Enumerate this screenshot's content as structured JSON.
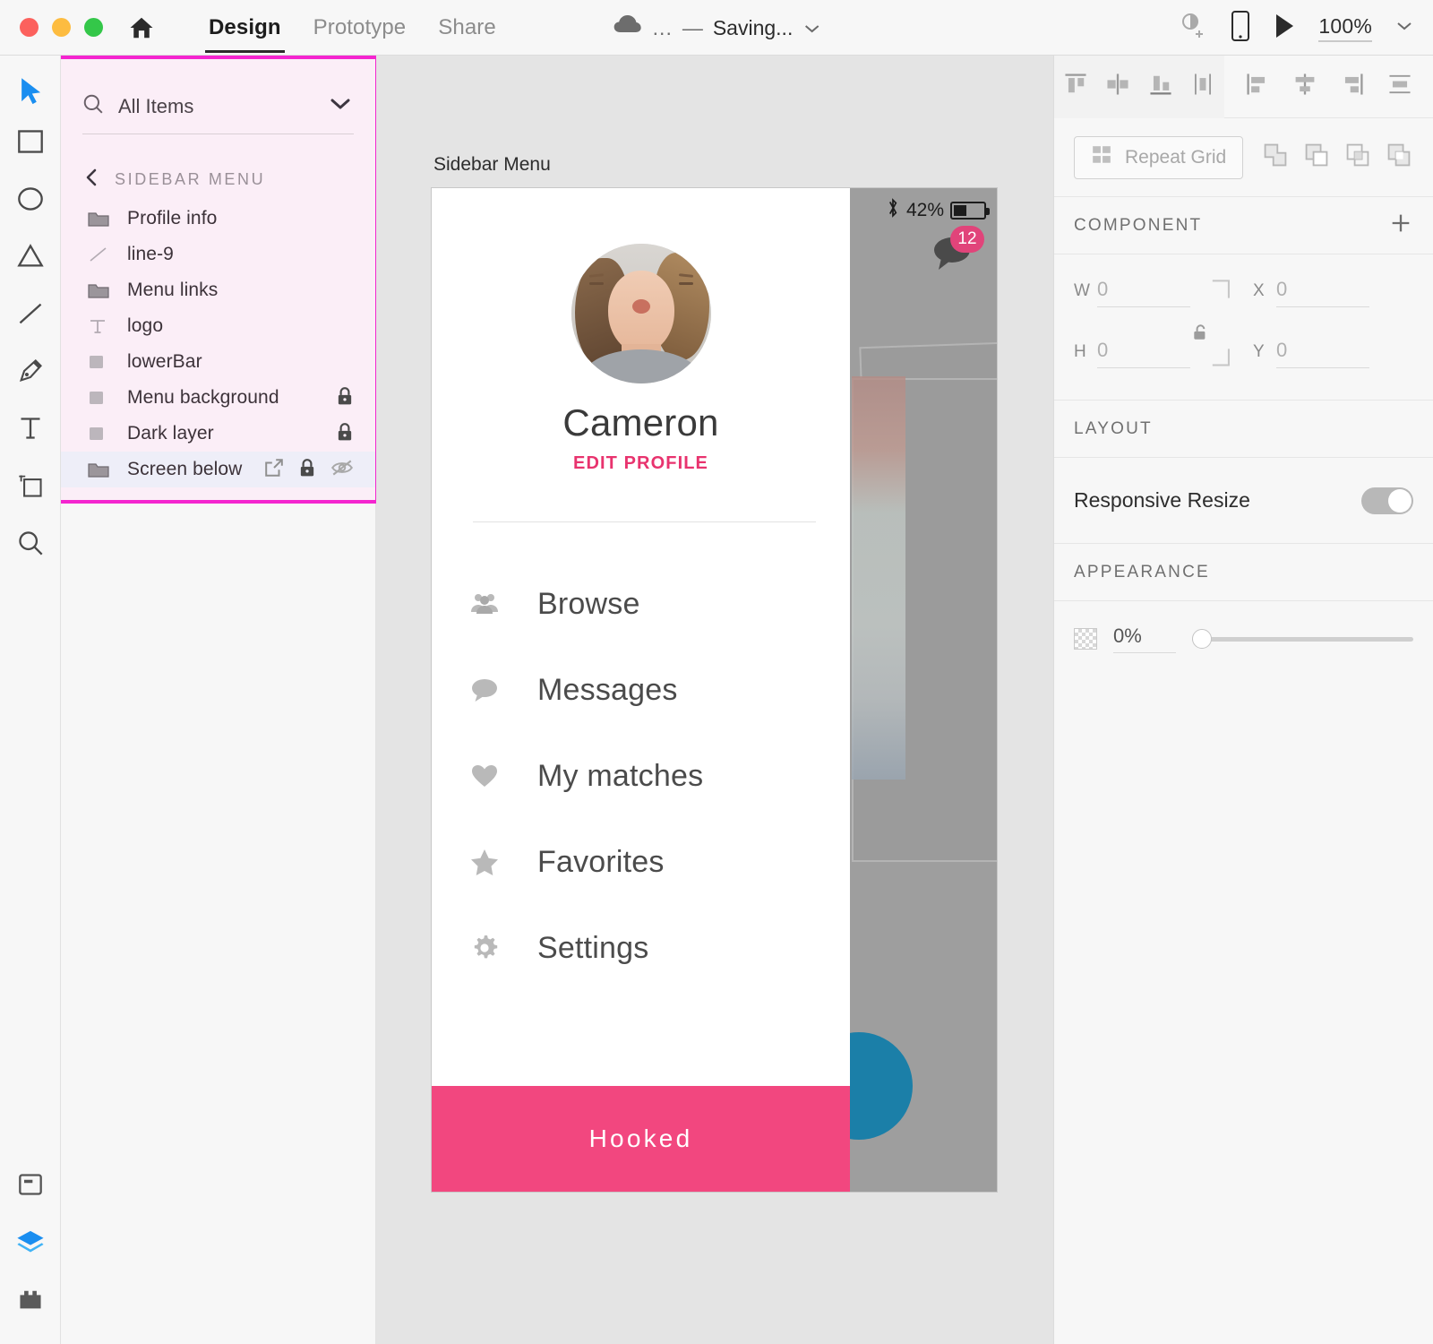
{
  "window": {
    "traffic_lights": [
      "close",
      "minimize",
      "maximize"
    ],
    "home_icon": "home-icon"
  },
  "topbar": {
    "tabs": [
      {
        "label": "Design",
        "active": true
      },
      {
        "label": "Prototype",
        "active": false
      },
      {
        "label": "Share",
        "active": false
      }
    ],
    "document": {
      "cloud_icon": "cloud-icon",
      "ellipsis": "...",
      "dash": "—",
      "status": "Saving...",
      "chevron": "chevron-down-icon"
    },
    "right": {
      "invite_icon": "add-collaborator-icon",
      "device_preview_icon": "mobile-preview-icon",
      "play_icon": "play-icon",
      "zoom_level": "100%",
      "zoom_chevron": "chevron-down-icon"
    }
  },
  "toolbar": {
    "tools": [
      {
        "name": "select-tool",
        "icon": "cursor-arrow-icon",
        "active": true
      },
      {
        "name": "rectangle-tool",
        "icon": "rectangle-icon",
        "active": false
      },
      {
        "name": "ellipse-tool",
        "icon": "ellipse-icon",
        "active": false
      },
      {
        "name": "polygon-tool",
        "icon": "triangle-icon",
        "active": false
      },
      {
        "name": "line-tool",
        "icon": "line-icon",
        "active": false
      },
      {
        "name": "pen-tool",
        "icon": "pen-icon",
        "active": false
      },
      {
        "name": "text-tool",
        "icon": "text-t-icon",
        "active": false
      },
      {
        "name": "artboard-tool",
        "icon": "artboard-icon",
        "active": false
      },
      {
        "name": "zoom-tool",
        "icon": "magnifier-icon",
        "active": false
      }
    ],
    "bottom_tools": [
      {
        "name": "assets-panel",
        "icon": "assets-panel-icon",
        "active": false
      },
      {
        "name": "layers-panel",
        "icon": "layers-stack-icon",
        "active": true
      },
      {
        "name": "plugins-panel",
        "icon": "plugin-icon",
        "active": false
      }
    ]
  },
  "layers_panel": {
    "highlight_color": "#f425cf",
    "background": "#fbeef7",
    "search": {
      "icon": "search-icon",
      "value": "All Items",
      "placeholder": "All Items",
      "chevron": "chevron-down-icon"
    },
    "group": {
      "back_icon": "chevron-left-icon",
      "title": "SIDEBAR MENU"
    },
    "items": [
      {
        "label": "Profile info",
        "icon": "folder-icon",
        "locked": false,
        "hidden": false,
        "link": false,
        "selected": false
      },
      {
        "label": "line-9",
        "icon": "line-icon",
        "locked": false,
        "hidden": false,
        "link": false,
        "selected": false
      },
      {
        "label": "Menu links",
        "icon": "folder-icon",
        "locked": false,
        "hidden": false,
        "link": false,
        "selected": false
      },
      {
        "label": "logo",
        "icon": "text-t-icon",
        "locked": false,
        "hidden": false,
        "link": false,
        "selected": false
      },
      {
        "label": "lowerBar",
        "icon": "rectangle-icon",
        "locked": false,
        "hidden": false,
        "link": false,
        "selected": false
      },
      {
        "label": "Menu background",
        "icon": "rectangle-icon",
        "locked": true,
        "hidden": false,
        "link": false,
        "selected": false
      },
      {
        "label": "Dark layer",
        "icon": "rectangle-icon",
        "locked": true,
        "hidden": false,
        "link": false,
        "selected": false
      },
      {
        "label": "Screen below",
        "icon": "folder-icon",
        "locked": true,
        "hidden": true,
        "link": true,
        "selected": true
      }
    ]
  },
  "canvas": {
    "artboard_label": "Sidebar Menu",
    "artboard": {
      "status_bar": {
        "bluetooth_icon": "bluetooth-icon",
        "battery_percent": "42%",
        "battery_icon": "battery-icon"
      },
      "chat_badge": {
        "icon": "chat-bubble-icon",
        "count": "12",
        "color": "#e1447a"
      },
      "profile": {
        "avatar": "user-avatar",
        "name": "Cameron",
        "edit_link": "EDIT PROFILE",
        "edit_link_color": "#e8336e"
      },
      "menu_items": [
        {
          "label": "Browse",
          "icon": "people-group-icon"
        },
        {
          "label": "Messages",
          "icon": "chat-bubble-icon"
        },
        {
          "label": "My matches",
          "icon": "heart-icon"
        },
        {
          "label": "Favorites",
          "icon": "star-icon"
        },
        {
          "label": "Settings",
          "icon": "gear-icon"
        }
      ],
      "bottom_bar": {
        "label": "Hooked",
        "color": "#f2477f"
      }
    }
  },
  "properties_panel": {
    "align_icons": [
      "align-top-icon",
      "align-vertical-center-icon",
      "align-bottom-icon",
      "distribute-vertical-icon",
      "align-left-icon",
      "align-horizontal-center-icon",
      "align-right-icon",
      "distribute-horizontal-icon"
    ],
    "repeat_grid": {
      "icon": "repeat-grid-icon",
      "label": "Repeat Grid"
    },
    "boolean_ops": [
      "add-shape-icon",
      "subtract-shape-icon",
      "intersect-shape-icon",
      "exclude-shape-icon"
    ],
    "component": {
      "title": "COMPONENT",
      "add_icon": "plus-icon"
    },
    "transform": {
      "w_label": "W",
      "w_value": "0",
      "h_label": "H",
      "h_value": "0",
      "x_label": "X",
      "x_value": "0",
      "y_label": "Y",
      "y_value": "0",
      "lock_icon": "unlocked-aspect-ratio-icon"
    },
    "layout": {
      "title": "LAYOUT",
      "responsive_resize_label": "Responsive Resize",
      "responsive_resize_on": true
    },
    "appearance": {
      "title": "APPEARANCE",
      "opacity_icon": "opacity-checker-icon",
      "opacity_value": "0%"
    }
  }
}
